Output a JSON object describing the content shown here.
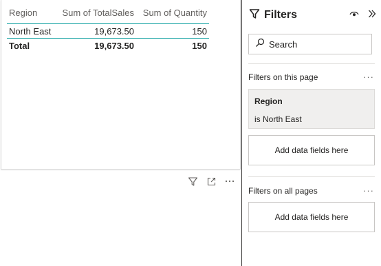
{
  "matrix": {
    "headers": [
      "Region",
      "Sum of TotalSales",
      "Sum of Quantity"
    ],
    "rows": [
      {
        "region": "North East",
        "total_sales": "19,673.50",
        "quantity": "150"
      }
    ],
    "total": {
      "label": "Total",
      "total_sales": "19,673.50",
      "quantity": "150"
    },
    "accent_color": "#16a3a3"
  },
  "visual_header_icons": [
    "filter-icon",
    "focus-mode-icon",
    "more-options-icon"
  ],
  "filters_pane": {
    "title": "Filters",
    "search_placeholder": "Search",
    "page_section_label": "Filters on this page",
    "page_filter": {
      "field": "Region",
      "condition": "is North East"
    },
    "page_add_label": "Add data fields here",
    "all_pages_section_label": "Filters on all pages",
    "all_pages_add_label": "Add data fields here",
    "more_glyph": "···"
  }
}
